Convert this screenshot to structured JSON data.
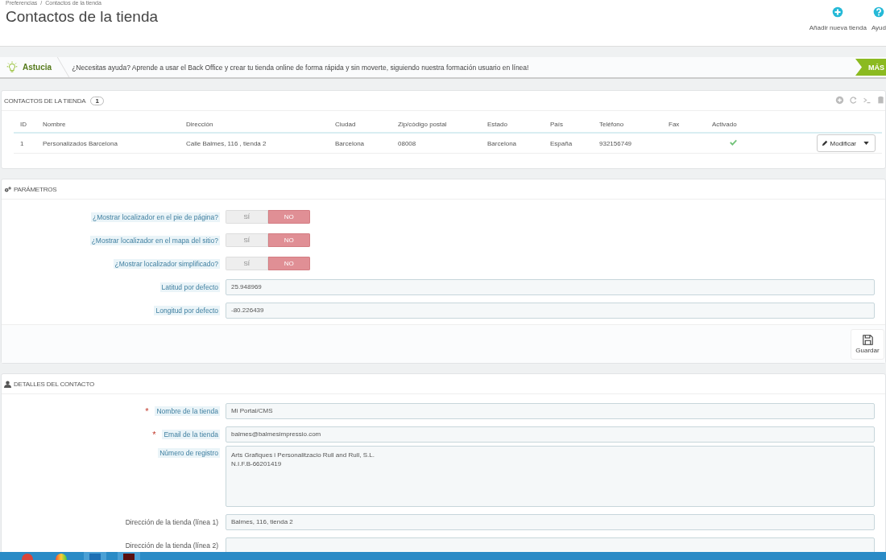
{
  "breadcrumb": [
    "Preferencias",
    "/",
    "Contactos de la tienda"
  ],
  "page_title": "Contactos de la tienda",
  "header_actions": [
    {
      "kind": "add",
      "label": "Añadir nueva tienda"
    },
    {
      "kind": "help",
      "label": "Ayud"
    }
  ],
  "tip": {
    "label": "Astucia",
    "text": "¿Necesitas ayuda? Aprende a usar el Back Office y crear tu tienda online de forma rápida y sin moverte, siguiendo nuestra formación usuario en línea!",
    "button": "MÁS"
  },
  "contacts_panel": {
    "title": "CONTACTOS DE LA TIENDA",
    "count": "1",
    "columns": [
      "ID",
      "Nombre",
      "Dirección",
      "Ciudad",
      "Zip/código postal",
      "Estado",
      "País",
      "Teléfono",
      "Fax",
      "Activado"
    ],
    "rows": [
      {
        "cells": [
          "1",
          "Personalizados Barcelona",
          "Calle Balmes, 116 , tienda 2",
          "Barcelona",
          "08008",
          "Barcelona",
          "España",
          "932156749",
          ""
        ],
        "active": true,
        "action": "Modificar"
      }
    ]
  },
  "params_panel": {
    "title": "PARÁMETROS",
    "fields": [
      {
        "kind": "switch",
        "label": "¿Mostrar localizador en el pie de página?",
        "options": [
          "SÍ",
          "NO"
        ],
        "on": false
      },
      {
        "kind": "switch",
        "label": "¿Mostrar localizador en el mapa del sitio?",
        "options": [
          "SÍ",
          "NO"
        ],
        "on": false
      },
      {
        "kind": "switch",
        "label": "¿Mostrar localizador simplificado?",
        "options": [
          "SÍ",
          "NO"
        ],
        "on": false
      },
      {
        "kind": "text",
        "label": "Latitud por defecto",
        "value": "25.948969"
      },
      {
        "kind": "text",
        "label": "Longitud por defecto",
        "value": "-80.226439"
      }
    ],
    "save": "Guardar"
  },
  "details_panel": {
    "title": "DETALLES DEL CONTACTO",
    "fields": [
      {
        "kind": "text",
        "label": "Nombre de la tienda",
        "required": true,
        "hint": true,
        "value": "Mi Portal/CMS"
      },
      {
        "kind": "text",
        "label": "Email de la tienda",
        "required": true,
        "hint": true,
        "value": "balmes@balmesimpressio.com"
      },
      {
        "kind": "textarea",
        "label": "Número de registro",
        "required": false,
        "hint": true,
        "value": "Arts Grafiques i Personalitzacio Rull and Rull, S.L.\nN.I.F.B-66201419"
      },
      {
        "kind": "text",
        "label": "Dirección de la tienda (línea 1)",
        "required": false,
        "hint": false,
        "value": "Balmes, 116, tienda 2"
      },
      {
        "kind": "text",
        "label": "Dirección de la tienda (línea 2)",
        "required": false,
        "hint": false
      }
    ],
    "required_mark": "*"
  }
}
